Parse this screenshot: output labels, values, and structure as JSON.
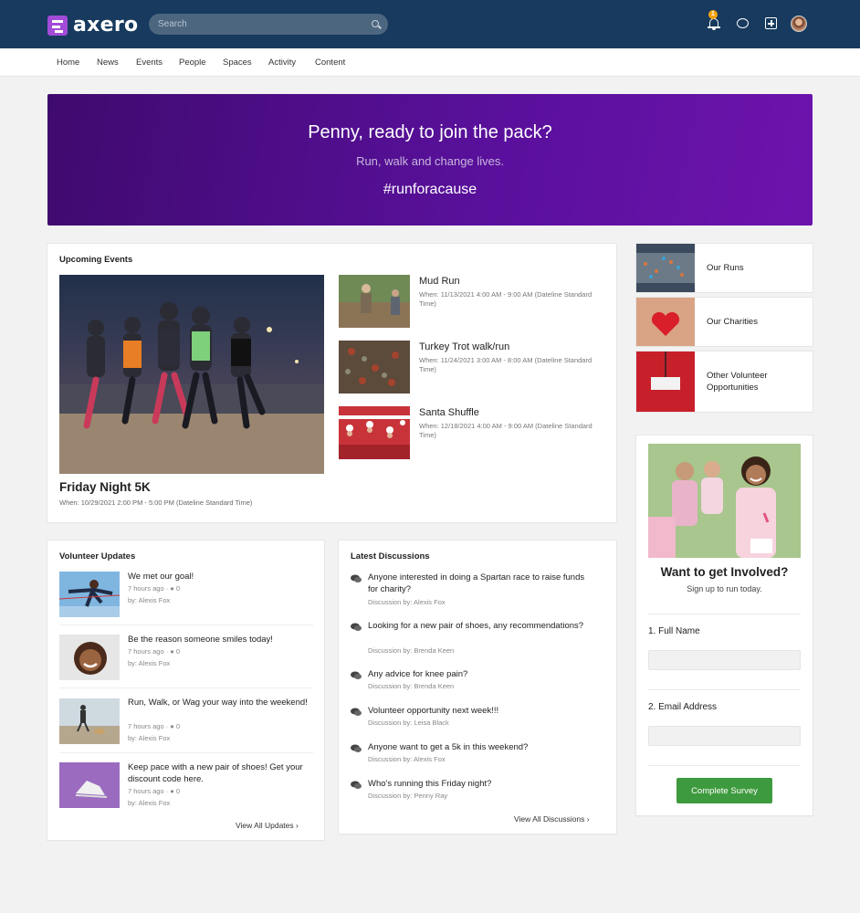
{
  "app": {
    "logo_text": "axero",
    "notification_count": "1",
    "accent_color": "#5b0f9e",
    "topbar_color": "#173a5e"
  },
  "search": {
    "placeholder": "Search"
  },
  "nav": {
    "items": [
      "Home",
      "News",
      "Events",
      "People",
      "Spaces",
      "Activity",
      "Content"
    ]
  },
  "banner": {
    "title": "Penny, ready to join the pack?",
    "subtitle": "Run, walk and change lives.",
    "hashtag": "#runforacause"
  },
  "upcoming_events": {
    "heading": "Upcoming Events",
    "featured": {
      "title": "Friday Night 5K",
      "when": "When: 10/29/2021 2:00 PM - 5:00 PM (Dateline Standard Time)"
    },
    "items": [
      {
        "title": "Mud Run",
        "when": "When: 11/13/2021 4:00 AM - 9:00 AM (Dateline Standard Time)"
      },
      {
        "title": "Turkey Trot walk/run",
        "when": "When: 11/24/2021 3:00 AM - 8:00 AM (Dateline Standard Time)"
      },
      {
        "title": "Santa Shuffle",
        "when": "When: 12/18/2021 4:00 AM - 9:00 AM (Dateline Standard Time)"
      }
    ]
  },
  "quick_links": [
    {
      "label": "Our Runs"
    },
    {
      "label": "Our Charities"
    },
    {
      "label": "Other Volunteer Opportunities"
    }
  ],
  "volunteer_updates": {
    "heading": "Volunteer Updates",
    "items": [
      {
        "title": "We met our goal!",
        "time": "7 hours ago",
        "comments": "0",
        "by": "by: Alexis Fox"
      },
      {
        "title": "Be the reason someone smiles today!",
        "time": "7 hours ago",
        "comments": "0",
        "by": "by: Alexis Fox"
      },
      {
        "title": "Run, Walk, or Wag your way into the weekend!",
        "time": "7 hours ago",
        "comments": "0",
        "by": "by: Alexis Fox"
      },
      {
        "title": "Keep pace with a new pair of shoes! Get your discount code here.",
        "time": "7 hours ago",
        "comments": "0",
        "by": "by: Alexis Fox"
      }
    ],
    "view_all": "View All Updates"
  },
  "latest_discussions": {
    "heading": "Latest Discussions",
    "items": [
      {
        "title": "Anyone interested in doing a Spartan race to raise funds for charity?",
        "by": "Discussion by: Alexis Fox"
      },
      {
        "title": "Looking for a new pair of shoes, any recommendations?",
        "by": "Discussion by: Brenda Keen"
      },
      {
        "title": "Any advice for knee pain?",
        "by": "Discussion by: Brenda Keen"
      },
      {
        "title": "Volunteer opportunity next week!!!",
        "by": "Discussion by: Leisa Black"
      },
      {
        "title": "Anyone want to get a 5k in this weekend?",
        "by": "Discussion by: Alexis Fox"
      },
      {
        "title": "Who's running this Friday night?",
        "by": "Discussion by: Penny Ray"
      }
    ],
    "view_all": "View All Discussions"
  },
  "survey": {
    "title": "Want to get Involved?",
    "subtitle": "Sign up to run today.",
    "fields": [
      {
        "label": "1. Full Name",
        "value": ""
      },
      {
        "label": "2. Email Address",
        "value": ""
      }
    ],
    "submit": "Complete Survey"
  }
}
